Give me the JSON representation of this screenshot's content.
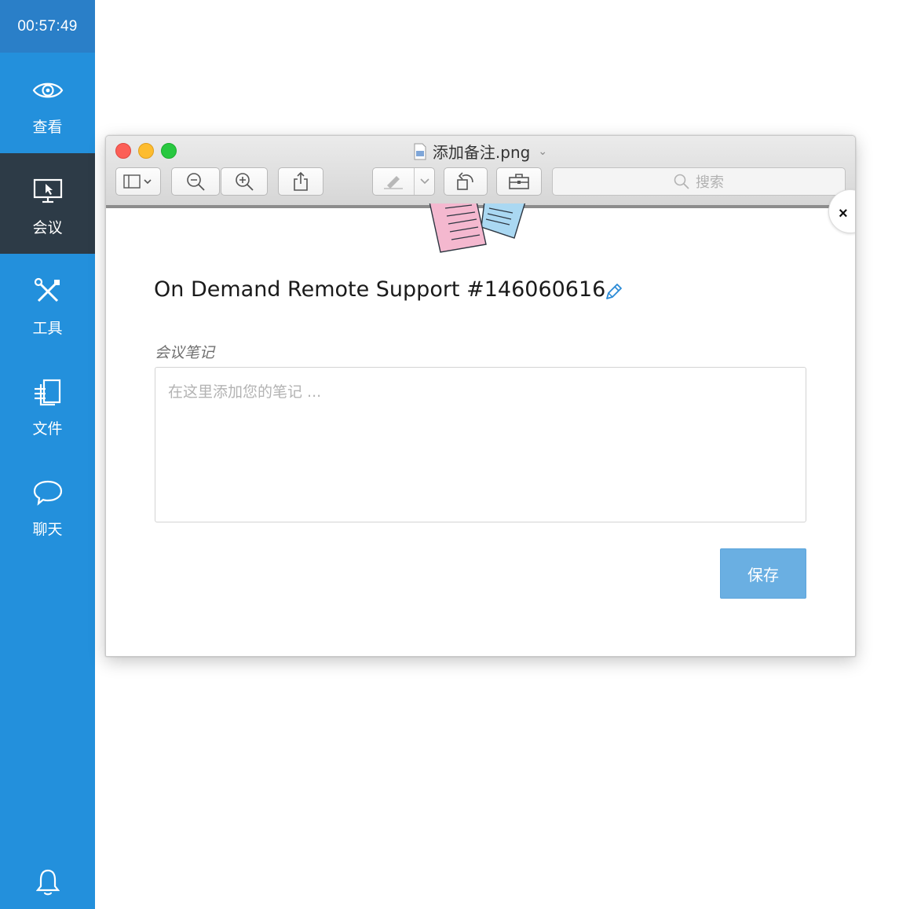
{
  "sidebar": {
    "timer": "00:57:49",
    "items": [
      {
        "label": "查看",
        "icon": "eye-icon"
      },
      {
        "label": "会议",
        "icon": "monitor-cursor-icon",
        "active": true
      },
      {
        "label": "工具",
        "icon": "tools-icon"
      },
      {
        "label": "文件",
        "icon": "files-icon"
      },
      {
        "label": "聊天",
        "icon": "chat-bubble-icon"
      }
    ],
    "bottom_icon": "bell-icon",
    "colors": {
      "background": "#2390dc",
      "active": "#2d3b47",
      "timer_bg": "#2a7fc8"
    }
  },
  "window": {
    "title": "添加备注.png",
    "toolbar": {
      "buttons": [
        "sidebar-toggle-icon",
        "zoom-out-icon",
        "zoom-in-icon",
        "share-icon",
        "markup-pen-icon",
        "rotate-icon",
        "toolbox-icon"
      ]
    },
    "search": {
      "placeholder": "搜索"
    }
  },
  "dialog": {
    "title": "On Demand Remote Support #146060616",
    "notes_label": "会议笔记",
    "notes_placeholder": "在这里添加您的笔记 ...",
    "notes_value": "",
    "save_label": "保存",
    "close_label": "×",
    "colors": {
      "save_button": "#6aafe2",
      "edit_icon": "#2a8ad6"
    }
  }
}
